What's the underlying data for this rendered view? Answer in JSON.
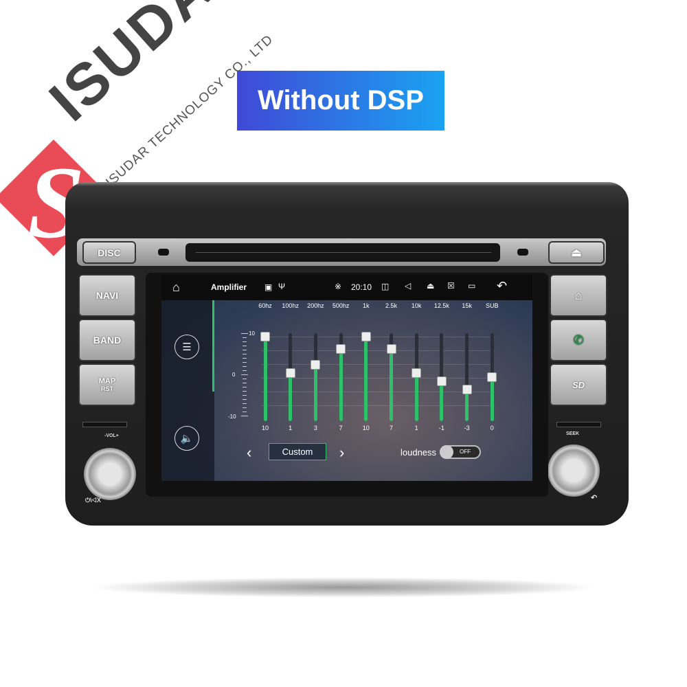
{
  "banner": {
    "text": "Without DSP",
    "colors": [
      "#3f49d6",
      "#1aa3f2"
    ]
  },
  "logo": {
    "brand": "ISUDAR",
    "subtitle": "ISUDAR TECHNOLOGY CO., LTD",
    "mark": "S",
    "color": "#e8424e"
  },
  "device": {
    "buttons_left": {
      "disc": "DISC",
      "navi": "NAVI",
      "band": "BAND",
      "map": "MAP",
      "rst": "RST"
    },
    "knob_left_label": "-VOL+",
    "knob_right_label": "SEEK",
    "power_label": "⏻\\◁X",
    "buttons_right": {
      "eject": "⏏",
      "home": "⌂",
      "phone": "✆",
      "sd": "SD"
    }
  },
  "statusbar": {
    "title": "Amplifier",
    "time": "20:10",
    "icons": [
      "home-icon",
      "image-icon",
      "usb-icon",
      "bluetooth-icon",
      "camera-icon",
      "volume-icon",
      "eject-icon",
      "screen-off-icon",
      "recent-apps-icon",
      "back-icon"
    ]
  },
  "eq": {
    "accent": "#2fc06a",
    "scale": {
      "max": "10",
      "mid": "0",
      "min": "-10"
    },
    "range": [
      -10,
      10
    ],
    "bands": [
      {
        "label": "60hz",
        "value": 10
      },
      {
        "label": "100hz",
        "value": 1
      },
      {
        "label": "200hz",
        "value": 3
      },
      {
        "label": "500hz",
        "value": 7
      },
      {
        "label": "1k",
        "value": 10
      },
      {
        "label": "2.5k",
        "value": 7
      },
      {
        "label": "10k",
        "value": 1
      },
      {
        "label": "12.5k",
        "value": -1
      },
      {
        "label": "15k",
        "value": -3
      },
      {
        "label": "SUB",
        "value": 0
      }
    ],
    "preset": "Custom",
    "loudness_label": "loudness",
    "loudness_state": "OFF"
  }
}
